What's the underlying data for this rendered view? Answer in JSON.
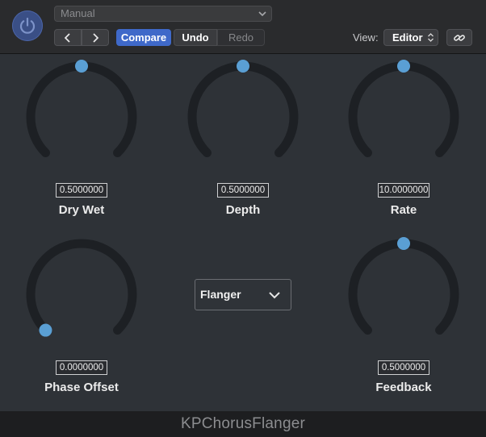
{
  "header": {
    "preset": "Manual",
    "compare_label": "Compare",
    "undo_label": "Undo",
    "redo_label": "Redo",
    "view_label": "View:",
    "view_value": "Editor"
  },
  "knobs": [
    {
      "id": "dry-wet",
      "label": "Dry Wet",
      "value_text": "0.5000000",
      "position": 0.5
    },
    {
      "id": "depth",
      "label": "Depth",
      "value_text": "0.5000000",
      "position": 0.5
    },
    {
      "id": "rate",
      "label": "Rate",
      "value_text": "10.0000000",
      "position": 0.5
    },
    {
      "id": "phase-offset",
      "label": "Phase Offset",
      "value_text": "0.0000000",
      "position": 0.0
    },
    {
      "id": "feedback",
      "label": "Feedback",
      "value_text": "0.5000000",
      "position": 0.5
    }
  ],
  "mode": {
    "selected": "Flanger"
  },
  "footer": {
    "plugin_name": "KPChorusFlanger"
  },
  "colors": {
    "knob_track": "#1d2024",
    "knob_handle": "#5a9fd4",
    "compare_active": "#3f69c9",
    "power_button": "#3a4f86"
  }
}
